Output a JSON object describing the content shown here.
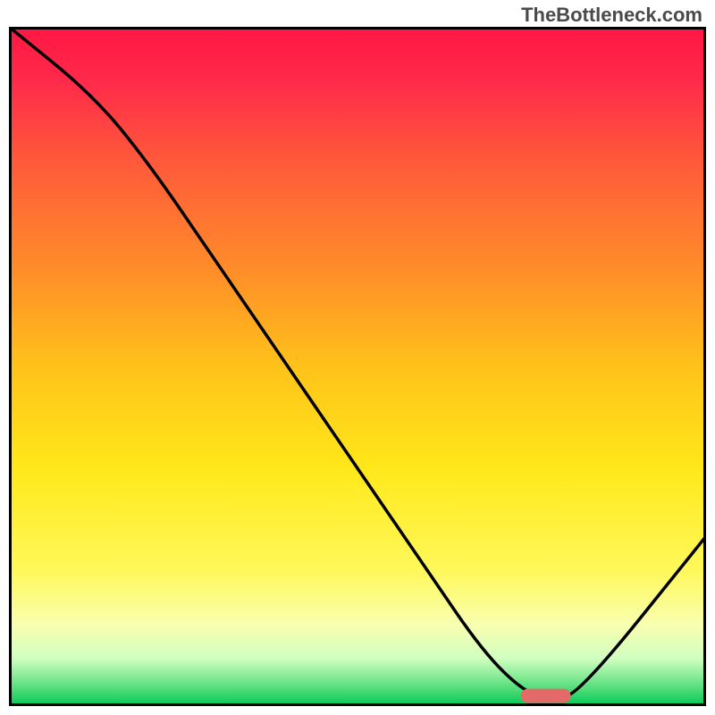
{
  "watermark": "TheBottleneck.com",
  "chart_data": {
    "type": "line",
    "title": "",
    "xlabel": "",
    "ylabel": "",
    "xlim": [
      0,
      100
    ],
    "ylim": [
      0,
      100
    ],
    "series": [
      {
        "name": "curve",
        "x": [
          0,
          12,
          20,
          30,
          40,
          50,
          60,
          68,
          74,
          78,
          82,
          100
        ],
        "values": [
          100,
          90,
          80,
          65,
          50,
          35,
          20,
          8,
          2,
          1,
          2,
          25
        ]
      }
    ],
    "marker": {
      "x": 77,
      "y": 1.5,
      "color": "#e46a6a"
    },
    "gradient_stops": [
      {
        "offset": 0.0,
        "color": "#ff1744"
      },
      {
        "offset": 0.08,
        "color": "#ff2a4a"
      },
      {
        "offset": 0.2,
        "color": "#ff5a3a"
      },
      {
        "offset": 0.35,
        "color": "#ff8a2a"
      },
      {
        "offset": 0.5,
        "color": "#ffc21a"
      },
      {
        "offset": 0.65,
        "color": "#ffe81a"
      },
      {
        "offset": 0.8,
        "color": "#fff85a"
      },
      {
        "offset": 0.88,
        "color": "#f8ffb0"
      },
      {
        "offset": 0.93,
        "color": "#d0ffc0"
      },
      {
        "offset": 0.97,
        "color": "#60e080"
      },
      {
        "offset": 1.0,
        "color": "#00c853"
      }
    ],
    "border_color": "#000000",
    "curve_color": "#000000"
  }
}
